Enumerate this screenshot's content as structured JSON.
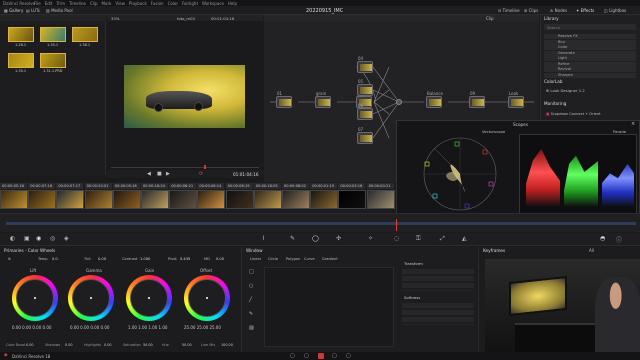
{
  "window": {
    "app_title": "DaVinci Resolve",
    "menu": [
      "File",
      "Edit",
      "Trim",
      "Timeline",
      "Clip",
      "Mark",
      "View",
      "Playback",
      "Fusion",
      "Color",
      "Fairlight",
      "Workspace",
      "Help"
    ]
  },
  "toolbar": {
    "gallery": "Gallery",
    "luts": "LUTs",
    "media_pool": "Media Pool",
    "project_title": "20220915_IMC",
    "clip_label": "Clip",
    "timeline": "Timeline",
    "clips": "Clips",
    "nodes": "Nodes",
    "effects": "Effects",
    "lightbox": "Lightbox"
  },
  "viewer": {
    "zoom": "33%",
    "clip_name": "foto_m03",
    "timecode_top": "00:01:04:16",
    "timecode": "01:01:04:16"
  },
  "gallery": {
    "stills": [
      {
        "label": "1.26.1"
      },
      {
        "label": "1.35.1"
      },
      {
        "label": "1.38.1"
      },
      {
        "label": "1.30.1"
      },
      {
        "label": "1.31.1.PRD"
      }
    ]
  },
  "library": {
    "header": "Library",
    "search": "Search",
    "items": [
      "Resolve FX",
      "Blur",
      "Color",
      "Generate",
      "Light",
      "Refine",
      "Revival",
      "Sharpen"
    ],
    "colorlab": "ColorLab",
    "colorlab_item": "Look Designer 1.2",
    "monitoring": "Monitoring",
    "monitoring_item": "Scopebox Connect + Orient"
  },
  "scopes": {
    "title": "Scopes",
    "vectorscope": "Vectorscope",
    "parade": "Parade"
  },
  "nodes": [
    {
      "label": "01"
    },
    {
      "label": "grain"
    },
    {
      "label": "03"
    },
    {
      "label": "04"
    },
    {
      "label": "05"
    },
    {
      "label": "06"
    },
    {
      "label": "07"
    },
    {
      "label": "Balance"
    },
    {
      "label": "09"
    },
    {
      "label": "Look"
    },
    {
      "label": "11"
    }
  ],
  "timeline": {
    "clips": [
      {
        "tc": "00:00:05:16",
        "num": "03"
      },
      {
        "tc": "00:00:07:16",
        "num": "04"
      },
      {
        "tc": "00:00:07:17",
        "num": "05"
      },
      {
        "tc": "00:00:20:01",
        "num": "06"
      },
      {
        "tc": "00:00:05:16",
        "num": "07"
      },
      {
        "tc": "00:00:18:24",
        "num": "08"
      },
      {
        "tc": "00:00:06:21",
        "num": "09"
      },
      {
        "tc": "00:00:06:14",
        "num": "10"
      },
      {
        "tc": "00:00:06:19",
        "num": "11"
      },
      {
        "tc": "00:00:18:05",
        "num": "12"
      },
      {
        "tc": "00:00:08:02",
        "num": "13"
      },
      {
        "tc": "00:00:01:19",
        "num": "14"
      },
      {
        "tc": "00:00:03:16",
        "num": "15"
      },
      {
        "tc": "00:00:00:21",
        "num": "16"
      }
    ]
  },
  "primaries": {
    "title": "Primaries - Color Wheels",
    "temp_label": "Temp",
    "temp": "0.0",
    "tint_label": "Tint",
    "tint": "0.00",
    "contrast_label": "Contrast",
    "contrast": "1.000",
    "pivot_label": "Pivot",
    "pivot": "0.435",
    "md_label": "MD",
    "md": "0.00",
    "wheels": [
      {
        "name": "Lift",
        "vals": "0.00  0.00  0.00  0.00"
      },
      {
        "name": "Gamma",
        "vals": "0.00  0.00  0.00  0.00"
      },
      {
        "name": "Gain",
        "vals": "1.00  1.00  1.00  1.00"
      },
      {
        "name": "Offset",
        "vals": "25.00  25.00  25.00"
      }
    ],
    "bottom": [
      {
        "l": "Color Boost",
        "v": "0.00"
      },
      {
        "l": "Shadows",
        "v": "0.00"
      },
      {
        "l": "Highlights",
        "v": "0.00"
      },
      {
        "l": "Saturation",
        "v": "50.00"
      },
      {
        "l": "Hue",
        "v": "50.00"
      },
      {
        "l": "Lum Mix",
        "v": "100.00"
      }
    ]
  },
  "window_panel": {
    "title": "Window",
    "tabs": [
      "Linear",
      "Circle",
      "Polygon",
      "Curve",
      "Gradient"
    ],
    "transform": "Transform",
    "softness": "Softness"
  },
  "keyframes": {
    "title": "Keyframes",
    "filter": "All"
  },
  "statusbar": {
    "app": "DaVinci Resolve 18"
  }
}
